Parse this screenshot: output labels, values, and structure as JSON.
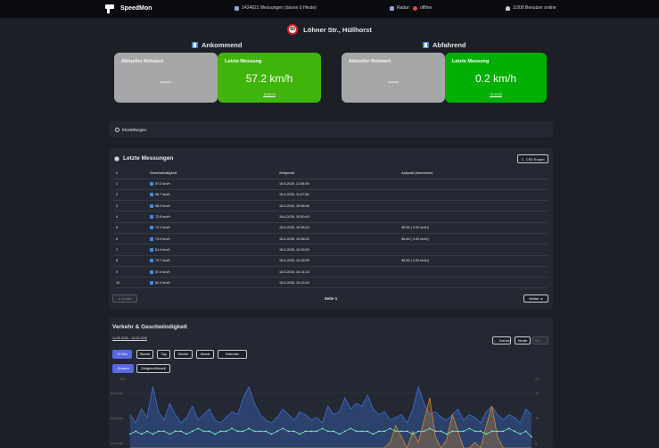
{
  "topbar": {
    "brand": "SpeedMon",
    "measurements": "1434621 Messungen (davon 0 Heute)",
    "radar_label": "Radar:",
    "radar_status": "offline",
    "users_online": "1/200 Benutzer online"
  },
  "location": {
    "limit": "50",
    "name": "Löhner Str., Hüllhorst"
  },
  "directions": [
    {
      "title": "Ankommend",
      "raw_label": "Aktueller Rohwert",
      "raw_value": "—",
      "last_label": "Letzte Messung",
      "last_value": "57.2 km/h",
      "last_time": "10:43:20"
    },
    {
      "title": "Abfahrend",
      "raw_label": "Aktueller Rohwert",
      "raw_value": "—",
      "last_label": "Letzte Messung",
      "last_value": "0.2 km/h",
      "last_time": "10:43:32"
    }
  ],
  "settings": {
    "label": "Einstellungen"
  },
  "measurements": {
    "title": "Letzte Messungen",
    "export_label": "CSV Export",
    "columns": [
      "#",
      "Geschwindigkeit",
      "Zeitpunkt",
      "Aufprall (Innenerte)"
    ],
    "rows": [
      {
        "n": "1",
        "speed": "57.2 km/h",
        "time": "15.6.2026, 11:08:09",
        "extra": ""
      },
      {
        "n": "2",
        "speed": "68.7 km/h",
        "time": "15.6.2026, 11:07:56",
        "extra": ""
      },
      {
        "n": "3",
        "speed": "88.9 km/h",
        "time": "15.6.2026, 10:58:46",
        "extra": ""
      },
      {
        "n": "4",
        "speed": "72.6 km/h",
        "time": "15.6.2026, 10:50:40",
        "extra": ""
      },
      {
        "n": "5",
        "speed": "70.1 km/h",
        "time": "15.6.2026, 10:38:04",
        "extra": "98.56 ( 0.00 km/h)"
      },
      {
        "n": "6",
        "speed": "74.9 km/h",
        "time": "15.6.2026, 10:38:02",
        "extra": "98.56 ( 0.00 km/h)"
      },
      {
        "n": "7",
        "speed": "61.9 km/h",
        "time": "15.6.2026, 10:29:20",
        "extra": ""
      },
      {
        "n": "8",
        "speed": "79.7 km/h",
        "time": "15.6.2026, 10:18:09",
        "extra": "98.56 ( 0.00 km/h)"
      },
      {
        "n": "9",
        "speed": "57.6 km/h",
        "time": "15.6.2026, 10:14:16",
        "extra": ""
      },
      {
        "n": "10",
        "speed": "82.4 km/h",
        "time": "15.6.2026, 10:13:20",
        "extra": ""
      }
    ],
    "prev_label": "Zurück",
    "page_label": "Seite 1",
    "next_label": "Weiter"
  },
  "traffic": {
    "title": "Verkehr & Geschwindigkeit",
    "range": "14.06.2026 – 16.06.2026",
    "back_label": "Zurück",
    "today_label": "Heute",
    "forward_label": "Vor",
    "intervals": [
      "10 Min",
      "Stunde",
      "Tag",
      "Woche",
      "Monat",
      "Kalender"
    ],
    "active_interval": "10 Min",
    "modes": [
      "Gesamt",
      "Zeitgeschlüsselt"
    ],
    "active_mode": "Gesamt",
    "colors": {
      "blue": "#3d6fd8",
      "orange": "#d48a2c",
      "teal": "#7de3c6"
    }
  },
  "chart_data": {
    "type": "line",
    "y_ticks_left": [
      "120",
      "80 km/h",
      "40 km/h",
      "20 km/h"
    ],
    "y_ticks_right": [
      "20",
      "15",
      "10",
      "5"
    ],
    "series": [
      {
        "values": [
          12,
          9,
          14,
          11,
          22,
          13,
          10,
          16,
          12,
          9,
          11,
          15,
          10,
          12,
          14,
          10,
          9,
          11,
          13,
          12,
          18,
          22,
          16,
          12,
          10,
          9,
          11,
          14,
          12,
          10,
          13,
          12,
          10,
          11,
          9,
          15,
          12,
          13,
          18,
          14,
          16,
          15,
          19,
          14,
          12,
          13,
          10,
          11,
          12,
          9,
          14,
          22,
          16,
          12,
          13,
          11,
          10,
          12,
          14,
          10,
          12,
          11,
          9,
          13,
          15,
          12,
          10,
          12,
          11,
          9,
          14,
          12
        ]
      },
      {
        "values": [
          0,
          0,
          0,
          0,
          0,
          0,
          0,
          0,
          0,
          0,
          0,
          0,
          0,
          0,
          0,
          0,
          0,
          0,
          0,
          0,
          0,
          0,
          0,
          0,
          0,
          0,
          0,
          0,
          0,
          0,
          0,
          0,
          0,
          0,
          0,
          0,
          0,
          0,
          0,
          0,
          0,
          0,
          0,
          0,
          0,
          0,
          2,
          8,
          4,
          0,
          6,
          2,
          10,
          18,
          4,
          0,
          3,
          12,
          6,
          0,
          0,
          2,
          0,
          8,
          15,
          4,
          0,
          0,
          0,
          0,
          0,
          0
        ]
      },
      {
        "values": [
          5,
          6,
          5,
          6,
          5,
          6,
          6,
          5,
          6,
          6,
          5,
          6,
          7,
          6,
          6,
          5,
          6,
          6,
          7,
          6,
          6,
          7,
          6,
          6,
          6,
          5,
          6,
          7,
          6,
          6,
          5,
          6,
          6,
          6,
          7,
          6,
          6,
          5,
          6,
          7,
          6,
          6,
          6,
          5,
          6,
          6,
          7,
          6,
          6,
          6,
          5,
          6,
          6,
          7,
          6,
          6,
          5,
          6,
          6,
          6,
          7,
          6,
          6,
          5,
          6,
          6,
          6,
          7,
          6,
          5,
          6,
          4
        ]
      }
    ],
    "y_max": 25
  }
}
